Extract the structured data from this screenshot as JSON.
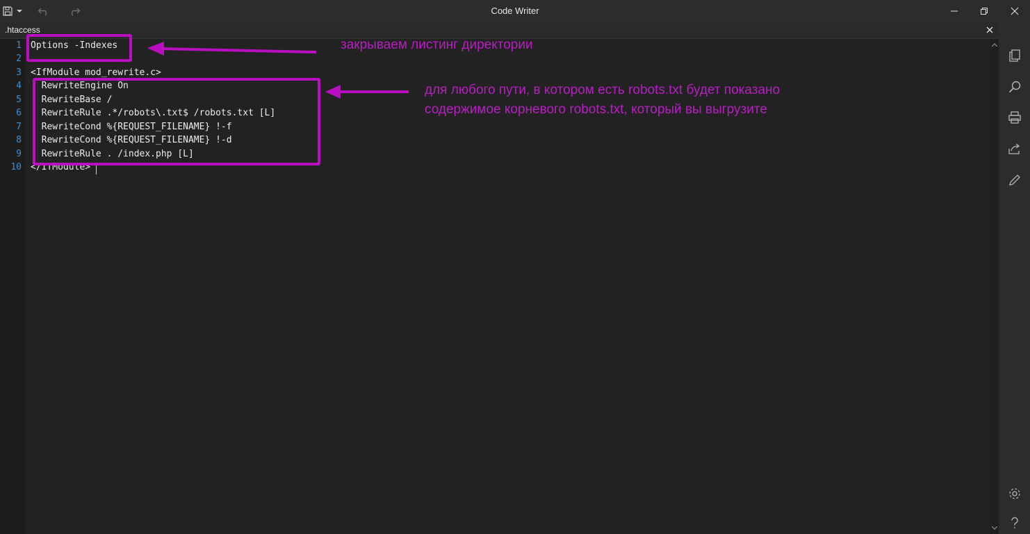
{
  "window": {
    "title": "Code Writer"
  },
  "tab": {
    "filename": ".htaccess"
  },
  "code_lines": [
    {
      "num": "1",
      "text": "Options -Indexes"
    },
    {
      "num": "2",
      "text": ""
    },
    {
      "num": "3",
      "text": "<IfModule mod_rewrite.c>"
    },
    {
      "num": "4",
      "text": "  RewriteEngine On"
    },
    {
      "num": "5",
      "text": "  RewriteBase /"
    },
    {
      "num": "6",
      "text": "  RewriteRule .*/robots\\.txt$ /robots.txt [L]"
    },
    {
      "num": "7",
      "text": "  RewriteCond %{REQUEST_FILENAME} !-f"
    },
    {
      "num": "8",
      "text": "  RewriteCond %{REQUEST_FILENAME} !-d"
    },
    {
      "num": "9",
      "text": "  RewriteRule . /index.php [L]"
    },
    {
      "num": "10",
      "text": "</IfModule>"
    }
  ],
  "annotations": {
    "note1": "закрываем листинг директории",
    "note2_line1": "для любого пути, в котором есть robots.txt будет показано",
    "note2_line2": "содержимое корневого robots.txt, который вы выгрузите",
    "color": "#b90fc0"
  },
  "icons": {
    "titlebar": [
      "save-icon",
      "dropdown-icon",
      "undo-icon",
      "redo-icon",
      "minimize-icon",
      "restore-icon",
      "close-icon"
    ],
    "sidebar": [
      "copy-icon",
      "search-icon",
      "print-icon",
      "share-icon",
      "edit-icon",
      "settings-icon",
      "help-icon"
    ]
  }
}
